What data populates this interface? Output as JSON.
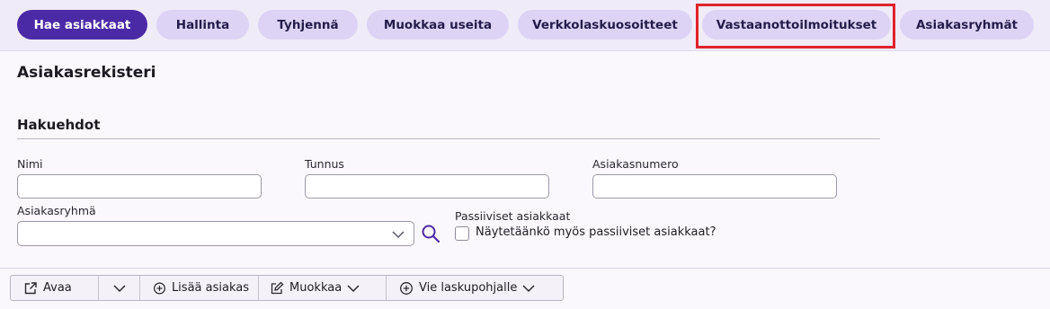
{
  "nav": {
    "tabs": [
      {
        "label": "Hae asiakkaat",
        "active": true
      },
      {
        "label": "Hallinta"
      },
      {
        "label": "Tyhjennä"
      },
      {
        "label": "Muokkaa useita"
      },
      {
        "label": "Verkkolaskuosoitteet"
      },
      {
        "label": "Vastaanottoilmoitukset",
        "highlighted": true
      },
      {
        "label": "Asiakasryhmät"
      }
    ]
  },
  "page": {
    "title": "Asiakasrekisteri",
    "section_title": "Hakuehdot"
  },
  "form": {
    "name_label": "Nimi",
    "name_value": "",
    "id_label": "Tunnus",
    "id_value": "",
    "number_label": "Asiakasnumero",
    "number_value": "",
    "group_label": "Asiakasryhmä",
    "group_value": "",
    "passive_label": "Passiiviset asiakkaat",
    "passive_checkbox_label": "Näytetäänkö myös passiiviset asiakkaat?",
    "passive_checked": false
  },
  "toolbar": {
    "open_label": "Avaa",
    "add_label": "Lisää asiakas",
    "edit_label": "Muokkaa",
    "template_label": "Vie laskupohjalle"
  },
  "colors": {
    "active_tab": "#4b2aa6",
    "tab": "#ddd3f4",
    "highlight": "#e1212b",
    "icon": "#4b2aa6"
  },
  "icons": [
    "external-link-icon",
    "chevron-down-icon",
    "plus-circle-icon",
    "edit-icon",
    "search-icon"
  ]
}
